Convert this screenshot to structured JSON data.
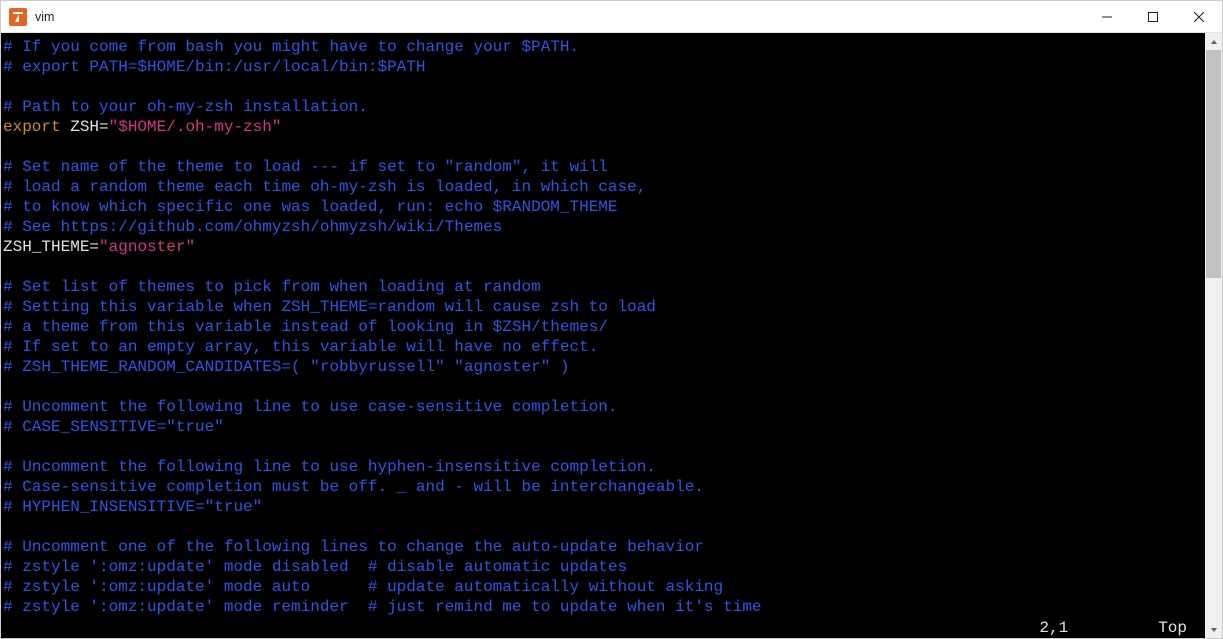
{
  "window": {
    "title": "vim",
    "minimize_icon": "minimize-icon",
    "maximize_icon": "maximize-icon",
    "close_icon": "close-icon"
  },
  "colors": {
    "comment": "#2b55e6",
    "keyword": "#d88a1a",
    "identifier": "#e2e2e2",
    "string": "#d63384",
    "background": "#000000"
  },
  "editor_lines": [
    {
      "segments": [
        {
          "cls": "c",
          "text": "# If you come from bash you might have to change your $PATH."
        }
      ]
    },
    {
      "segments": [
        {
          "cls": "c",
          "text": "# export PATH=$HOME/bin:/usr/local/bin:$PATH"
        }
      ]
    },
    {
      "segments": [
        {
          "cls": "",
          "text": ""
        }
      ]
    },
    {
      "segments": [
        {
          "cls": "c",
          "text": "# Path to your oh-my-zsh installation."
        }
      ]
    },
    {
      "segments": [
        {
          "cls": "kw",
          "text": "export"
        },
        {
          "cls": "id",
          "text": " ZSH"
        },
        {
          "cls": "op",
          "text": "="
        },
        {
          "cls": "str",
          "text": "\"$HOME/.oh-my-zsh\""
        }
      ]
    },
    {
      "segments": [
        {
          "cls": "",
          "text": ""
        }
      ]
    },
    {
      "segments": [
        {
          "cls": "c",
          "text": "# Set name of the theme to load --- if set to \"random\", it will"
        }
      ]
    },
    {
      "segments": [
        {
          "cls": "c",
          "text": "# load a random theme each time oh-my-zsh is loaded, in which case,"
        }
      ]
    },
    {
      "segments": [
        {
          "cls": "c",
          "text": "# to know which specific one was loaded, run: echo $RANDOM_THEME"
        }
      ]
    },
    {
      "segments": [
        {
          "cls": "c",
          "text": "# See https://github.com/ohmyzsh/ohmyzsh/wiki/Themes"
        }
      ]
    },
    {
      "segments": [
        {
          "cls": "id",
          "text": "ZSH_THEME"
        },
        {
          "cls": "op",
          "text": "="
        },
        {
          "cls": "str",
          "text": "\"agnoster\""
        }
      ]
    },
    {
      "segments": [
        {
          "cls": "",
          "text": ""
        }
      ]
    },
    {
      "segments": [
        {
          "cls": "c",
          "text": "# Set list of themes to pick from when loading at random"
        }
      ]
    },
    {
      "segments": [
        {
          "cls": "c",
          "text": "# Setting this variable when ZSH_THEME=random will cause zsh to load"
        }
      ]
    },
    {
      "segments": [
        {
          "cls": "c",
          "text": "# a theme from this variable instead of looking in $ZSH/themes/"
        }
      ]
    },
    {
      "segments": [
        {
          "cls": "c",
          "text": "# If set to an empty array, this variable will have no effect."
        }
      ]
    },
    {
      "segments": [
        {
          "cls": "c",
          "text": "# ZSH_THEME_RANDOM_CANDIDATES=( \"robbyrussell\" \"agnoster\" )"
        }
      ]
    },
    {
      "segments": [
        {
          "cls": "",
          "text": ""
        }
      ]
    },
    {
      "segments": [
        {
          "cls": "c",
          "text": "# Uncomment the following line to use case-sensitive completion."
        }
      ]
    },
    {
      "segments": [
        {
          "cls": "c",
          "text": "# CASE_SENSITIVE=\"true\""
        }
      ]
    },
    {
      "segments": [
        {
          "cls": "",
          "text": ""
        }
      ]
    },
    {
      "segments": [
        {
          "cls": "c",
          "text": "# Uncomment the following line to use hyphen-insensitive completion."
        }
      ]
    },
    {
      "segments": [
        {
          "cls": "c",
          "text": "# Case-sensitive completion must be off. _ and - will be interchangeable."
        }
      ]
    },
    {
      "segments": [
        {
          "cls": "c",
          "text": "# HYPHEN_INSENSITIVE=\"true\""
        }
      ]
    },
    {
      "segments": [
        {
          "cls": "",
          "text": ""
        }
      ]
    },
    {
      "segments": [
        {
          "cls": "c",
          "text": "# Uncomment one of the following lines to change the auto-update behavior"
        }
      ]
    },
    {
      "segments": [
        {
          "cls": "c",
          "text": "# zstyle ':omz:update' mode disabled  # disable automatic updates"
        }
      ]
    },
    {
      "segments": [
        {
          "cls": "c",
          "text": "# zstyle ':omz:update' mode auto      # update automatically without asking"
        }
      ]
    },
    {
      "segments": [
        {
          "cls": "c",
          "text": "# zstyle ':omz:update' mode reminder  # just remind me to update when it's time"
        }
      ]
    }
  ],
  "status": {
    "position": "2,1",
    "scroll": "Top"
  }
}
